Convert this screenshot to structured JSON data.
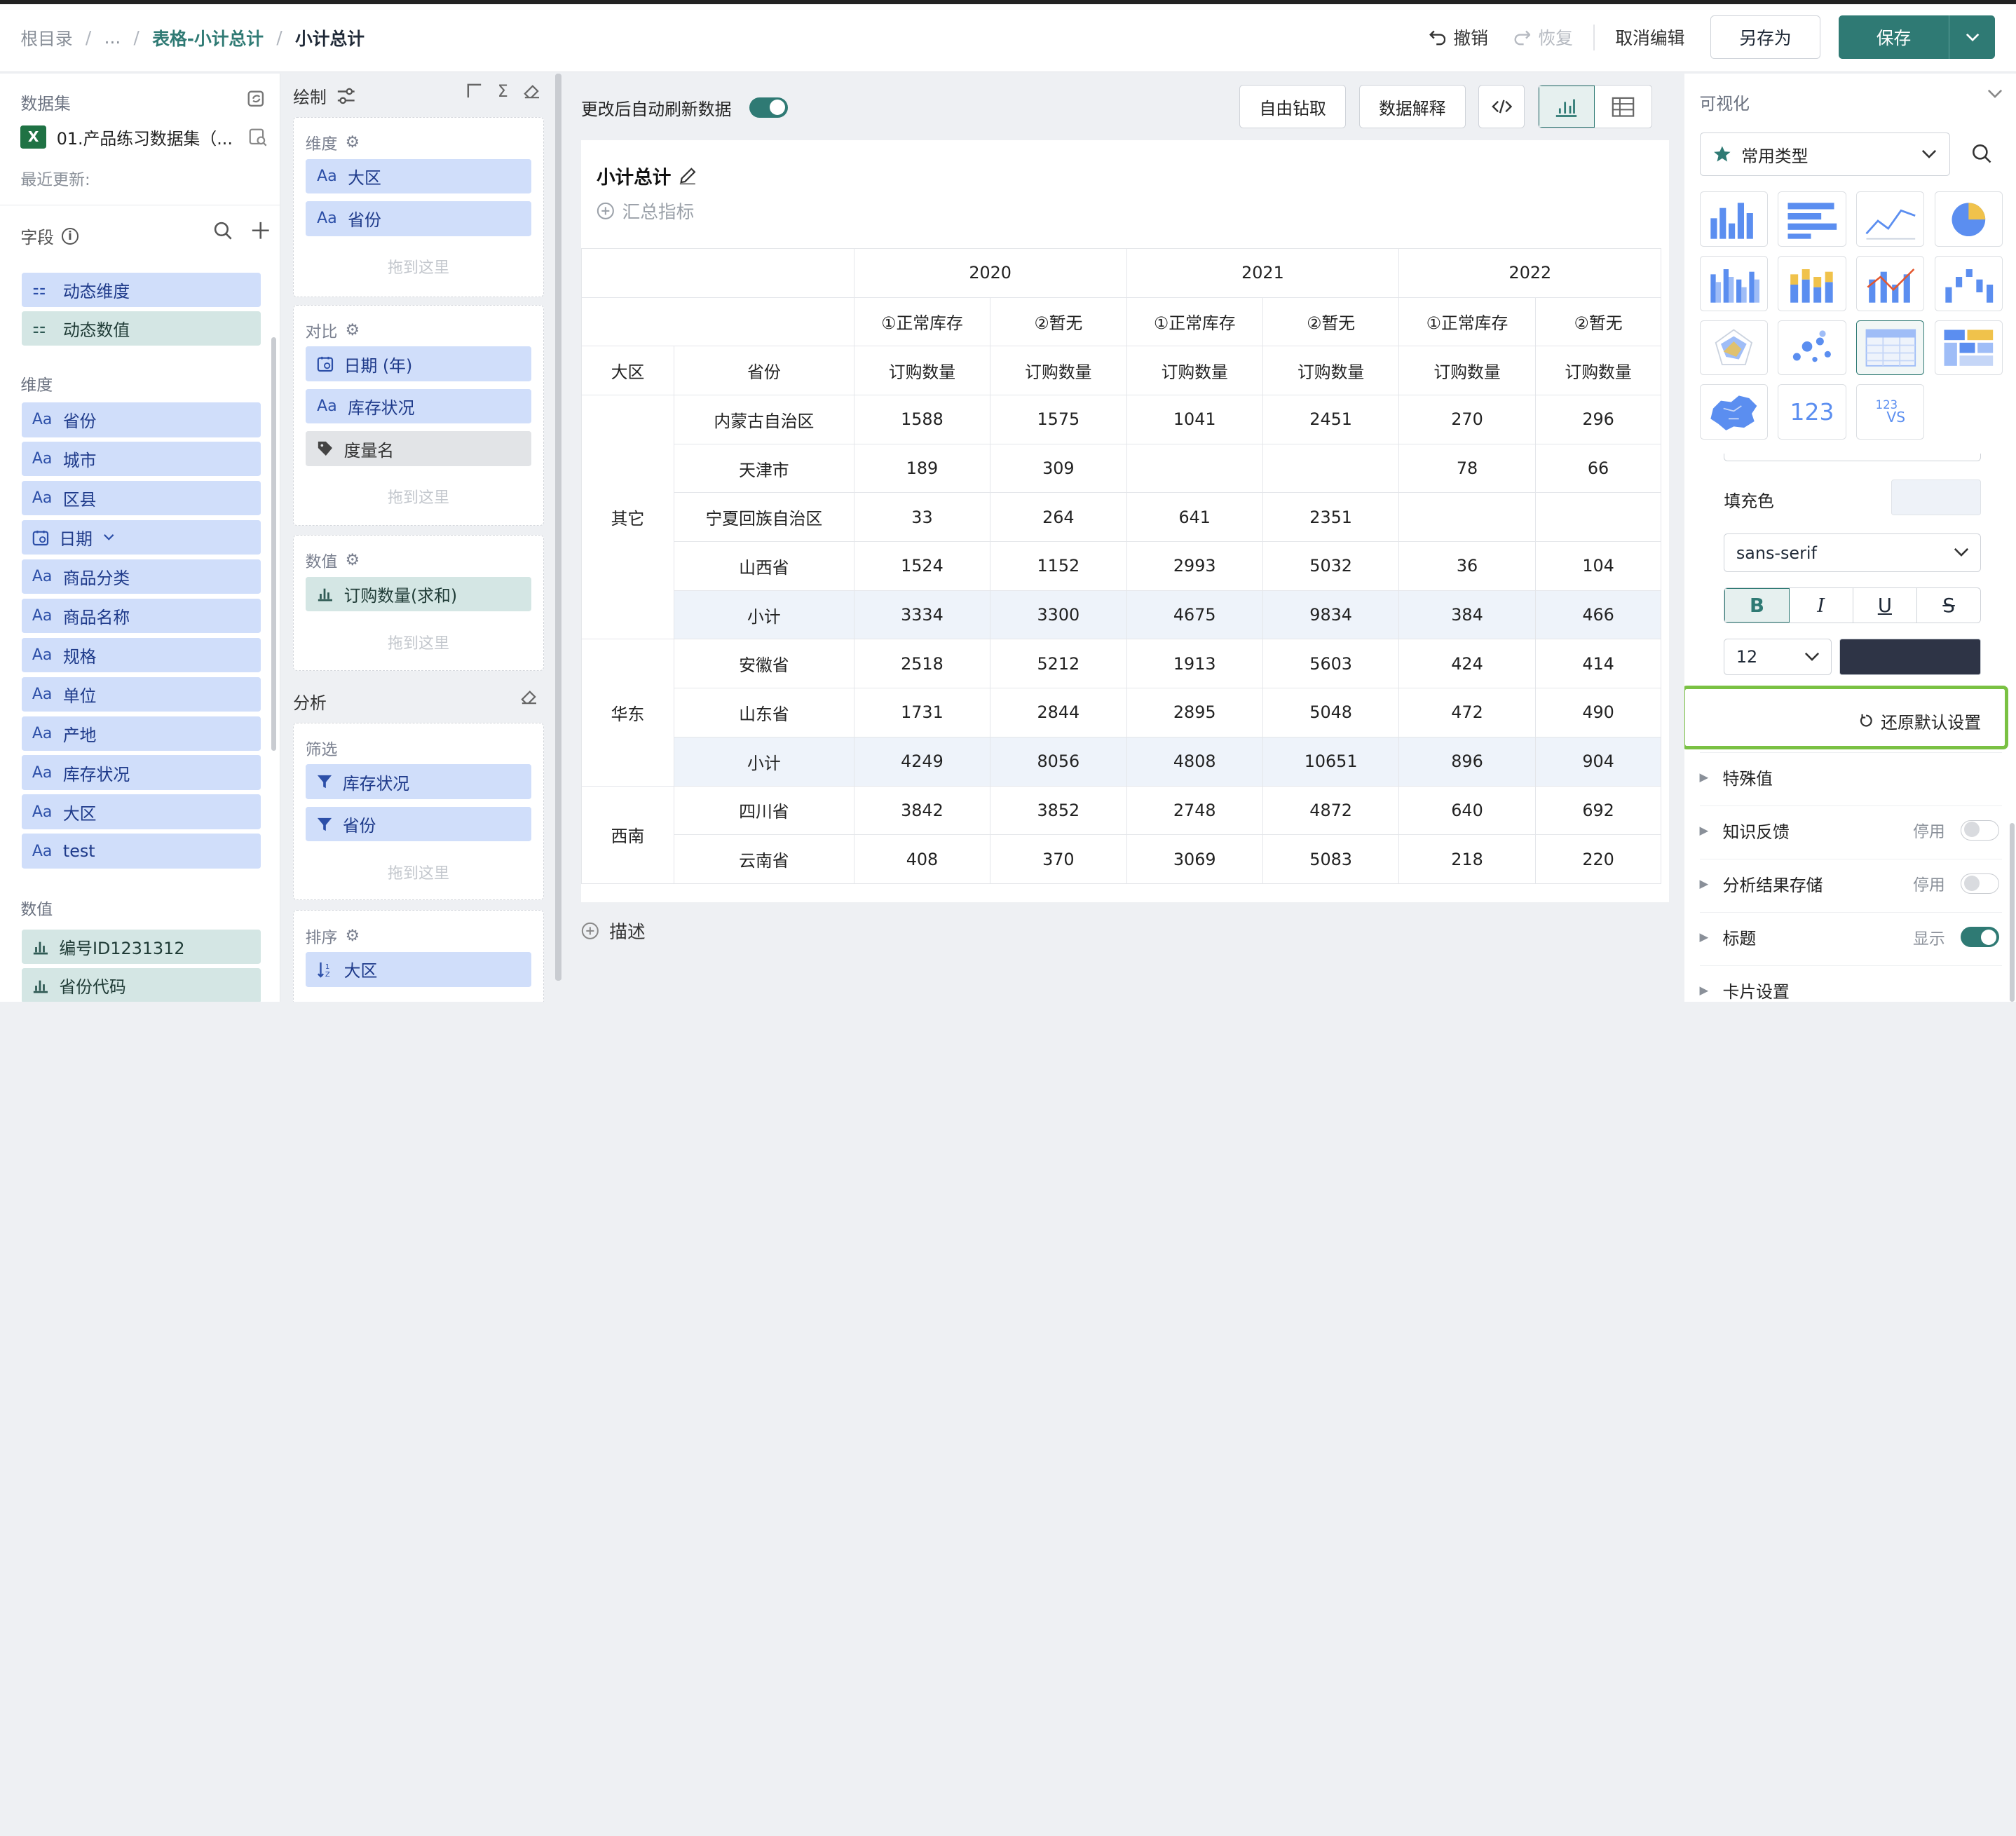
{
  "breadcrumb": {
    "root": "根目录",
    "ellipsis": "...",
    "parent": "表格-小计总计",
    "current": "小计总计",
    "sep": "/"
  },
  "toolbar": {
    "undo": "撤销",
    "redo": "恢复",
    "cancel_edit": "取消编辑",
    "save_as": "另存为",
    "save": "保存"
  },
  "dataset": {
    "title": "数据集",
    "file_name": "01.产品练习数据集（...",
    "recent_update": "最近更新:",
    "file_icon": "X"
  },
  "fields": {
    "title": "字段",
    "dynamic": [
      "动态维度",
      "动态数值"
    ],
    "dim_title": "维度",
    "dims": [
      {
        "label": "省份",
        "icon": "Aa"
      },
      {
        "label": "城市",
        "icon": "Aa"
      },
      {
        "label": "区县",
        "icon": "Aa"
      },
      {
        "label": "日期",
        "icon": "calendar"
      },
      {
        "label": "商品分类",
        "icon": "Aa"
      },
      {
        "label": "商品名称",
        "icon": "Aa"
      },
      {
        "label": "规格",
        "icon": "Aa"
      },
      {
        "label": "单位",
        "icon": "Aa"
      },
      {
        "label": "产地",
        "icon": "Aa"
      },
      {
        "label": "库存状况",
        "icon": "Aa"
      },
      {
        "label": "大区",
        "icon": "Aa"
      },
      {
        "label": "test",
        "icon": "Aa"
      }
    ],
    "mea_title": "数值",
    "measures": [
      "编号ID1231312",
      "省份代码"
    ]
  },
  "config": {
    "draw": "绘制",
    "dim_box": {
      "title": "维度",
      "items": [
        "大区",
        "省份"
      ],
      "drop": "拖到这里"
    },
    "compare_box": {
      "title": "对比",
      "items": [
        "日期 (年)",
        "库存状况",
        "度量名"
      ],
      "drop": "拖到这里"
    },
    "value_box": {
      "title": "数值",
      "items": [
        "订购数量(求和)"
      ],
      "drop": "拖到这里"
    },
    "analysis": "分析",
    "filter_box": {
      "title": "筛选",
      "items": [
        "库存状况",
        "省份"
      ],
      "drop": "拖到这里"
    },
    "sort_box": {
      "title": "排序",
      "items": [
        "大区"
      ]
    }
  },
  "main": {
    "auto_refresh": "更改后自动刷新数据",
    "drill": "自由钻取",
    "explain": "数据解释",
    "card_title": "小计总计",
    "summary_link": "汇总指标",
    "describe": "描述"
  },
  "table": {
    "years": [
      "2020",
      "2021",
      "2022"
    ],
    "status": [
      "①正常库存",
      "②暂无"
    ],
    "row_headers": [
      "大区",
      "省份"
    ],
    "measure": "订购数量",
    "rows": [
      {
        "region": "其它",
        "province": "内蒙古自治区",
        "vals": [
          "1588",
          "1575",
          "1041",
          "2451",
          "270",
          "296"
        ]
      },
      {
        "region": "",
        "province": "天津市",
        "vals": [
          "189",
          "309",
          "",
          "",
          "78",
          "66"
        ]
      },
      {
        "region": "",
        "province": "宁夏回族自治区",
        "vals": [
          "33",
          "264",
          "641",
          "2351",
          "",
          ""
        ]
      },
      {
        "region": "",
        "province": "山西省",
        "vals": [
          "1524",
          "1152",
          "2993",
          "5032",
          "36",
          "104"
        ]
      },
      {
        "region": "",
        "province": "小计",
        "vals": [
          "3334",
          "3300",
          "4675",
          "9834",
          "384",
          "466"
        ],
        "subtotal": true
      },
      {
        "region": "华东",
        "province": "安徽省",
        "vals": [
          "2518",
          "5212",
          "1913",
          "5603",
          "424",
          "414"
        ]
      },
      {
        "region": "",
        "province": "山东省",
        "vals": [
          "1731",
          "2844",
          "2895",
          "5048",
          "472",
          "490"
        ]
      },
      {
        "region": "",
        "province": "小计",
        "vals": [
          "4249",
          "8056",
          "4808",
          "10651",
          "896",
          "904"
        ],
        "subtotal": true
      },
      {
        "region": "西南",
        "province": "四川省",
        "vals": [
          "3842",
          "3852",
          "2748",
          "4872",
          "640",
          "692"
        ]
      },
      {
        "region": "",
        "province": "云南省",
        "vals": [
          "408",
          "370",
          "3069",
          "5083",
          "218",
          "220"
        ]
      }
    ]
  },
  "visual": {
    "title": "可视化",
    "type_select": "常用类型",
    "fill_color_label": "填充色",
    "font_family": "sans-serif",
    "font_size": "12",
    "styles": [
      "B",
      "I",
      "U",
      "S"
    ],
    "reset": "还原默认设置",
    "sections": [
      {
        "label": "特殊值",
        "state": "",
        "toggle": null
      },
      {
        "label": "知识反馈",
        "state": "停用",
        "toggle": false
      },
      {
        "label": "分析结果存储",
        "state": "停用",
        "toggle": false
      },
      {
        "label": "标题",
        "state": "显示",
        "toggle": true
      },
      {
        "label": "卡片设置",
        "state": "",
        "toggle": null
      }
    ],
    "tile_numbers": "123",
    "tile_vs": "VS",
    "fill_color": "#eef2f8",
    "text_color": "#2e3446",
    "accent": "#2f7a74"
  }
}
